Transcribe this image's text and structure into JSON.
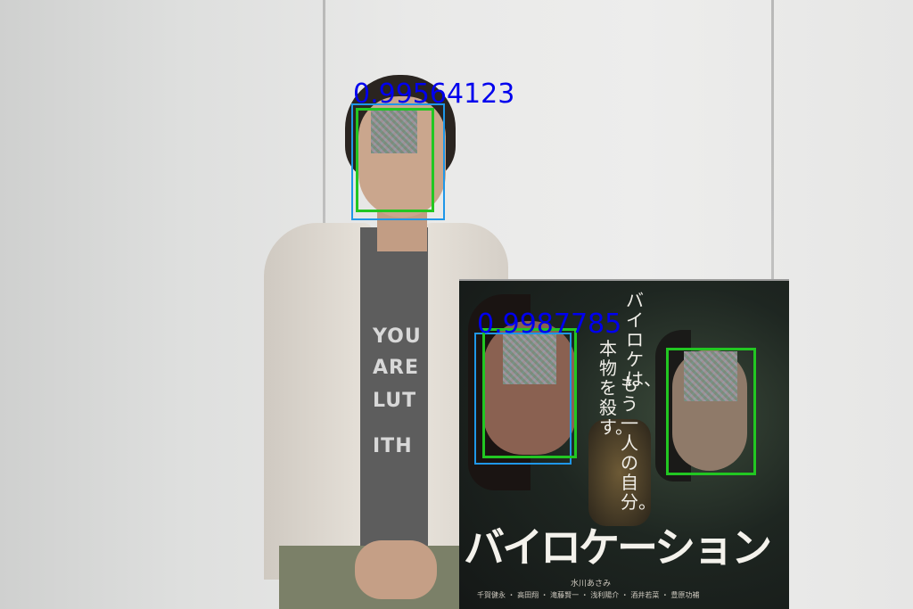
{
  "scene": {
    "description_hidden": "",
    "shirt_text": [
      "YOU",
      "ARE",
      "LUT",
      "ITH"
    ]
  },
  "poster": {
    "tagline_col1": "バイロケは、",
    "tagline_col2": "もう一人の自分。",
    "tagline_col3": "本物を殺す。",
    "title": "バイロケーション",
    "credit_1": "水川あさみ",
    "credit_2": "千賀健永 ・ 高田翔 ・ 滝藤賢一 ・ 浅利陽介 ・ 酒井若菜 ・ 豊原功補"
  },
  "detections": {
    "scores": [
      "0.99564123",
      "0.9987785"
    ],
    "colors": {
      "blue": "#1f97e8",
      "green": "#22c722",
      "label": "#0000ee"
    }
  }
}
